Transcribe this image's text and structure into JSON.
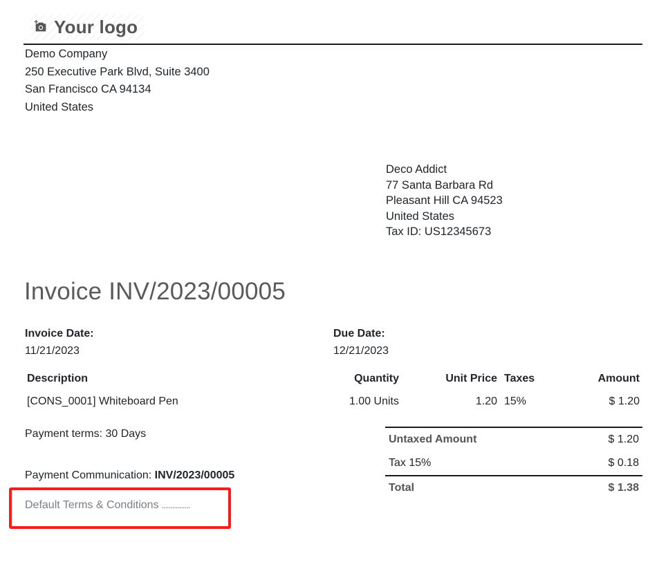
{
  "header": {
    "logo_text": "Your logo",
    "logo_icon": "camera-icon"
  },
  "company": {
    "name": "Demo Company",
    "street": "250 Executive Park Blvd, Suite 3400",
    "city": "San Francisco CA 94134",
    "country": "United States"
  },
  "partner": {
    "name": "Deco Addict",
    "street": "77 Santa Barbara Rd",
    "city": "Pleasant Hill CA 94523",
    "country": "United States",
    "tax_id": "Tax ID: US12345673"
  },
  "invoice": {
    "title": "Invoice INV/2023/00005",
    "date_label": "Invoice Date:",
    "date": "11/21/2023",
    "due_label": "Due Date:",
    "due": "12/21/2023"
  },
  "lines": {
    "headers": {
      "description": "Description",
      "quantity": "Quantity",
      "unit_price": "Unit Price",
      "taxes": "Taxes",
      "amount": "Amount"
    },
    "rows": [
      {
        "description": "[CONS_0001] Whiteboard Pen",
        "quantity": "1.00 Units",
        "unit_price": "1.20",
        "taxes": "15%",
        "amount": "$ 1.20"
      }
    ]
  },
  "payment": {
    "terms": "Payment terms: 30 Days",
    "communication_label": "Payment Communication: ",
    "communication_ref": "INV/2023/00005"
  },
  "totals": {
    "untaxed_label": "Untaxed Amount",
    "untaxed": "$ 1.20",
    "tax_label": "Tax 15%",
    "tax": "$ 0.18",
    "total_label": "Total",
    "total": "$ 1.38"
  },
  "terms": {
    "text": "Default Terms & Conditions",
    "dots": "................"
  },
  "colors": {
    "highlight": "#ff1a1a",
    "rule": "#1a1a1a",
    "title": "#5a5a5a"
  }
}
